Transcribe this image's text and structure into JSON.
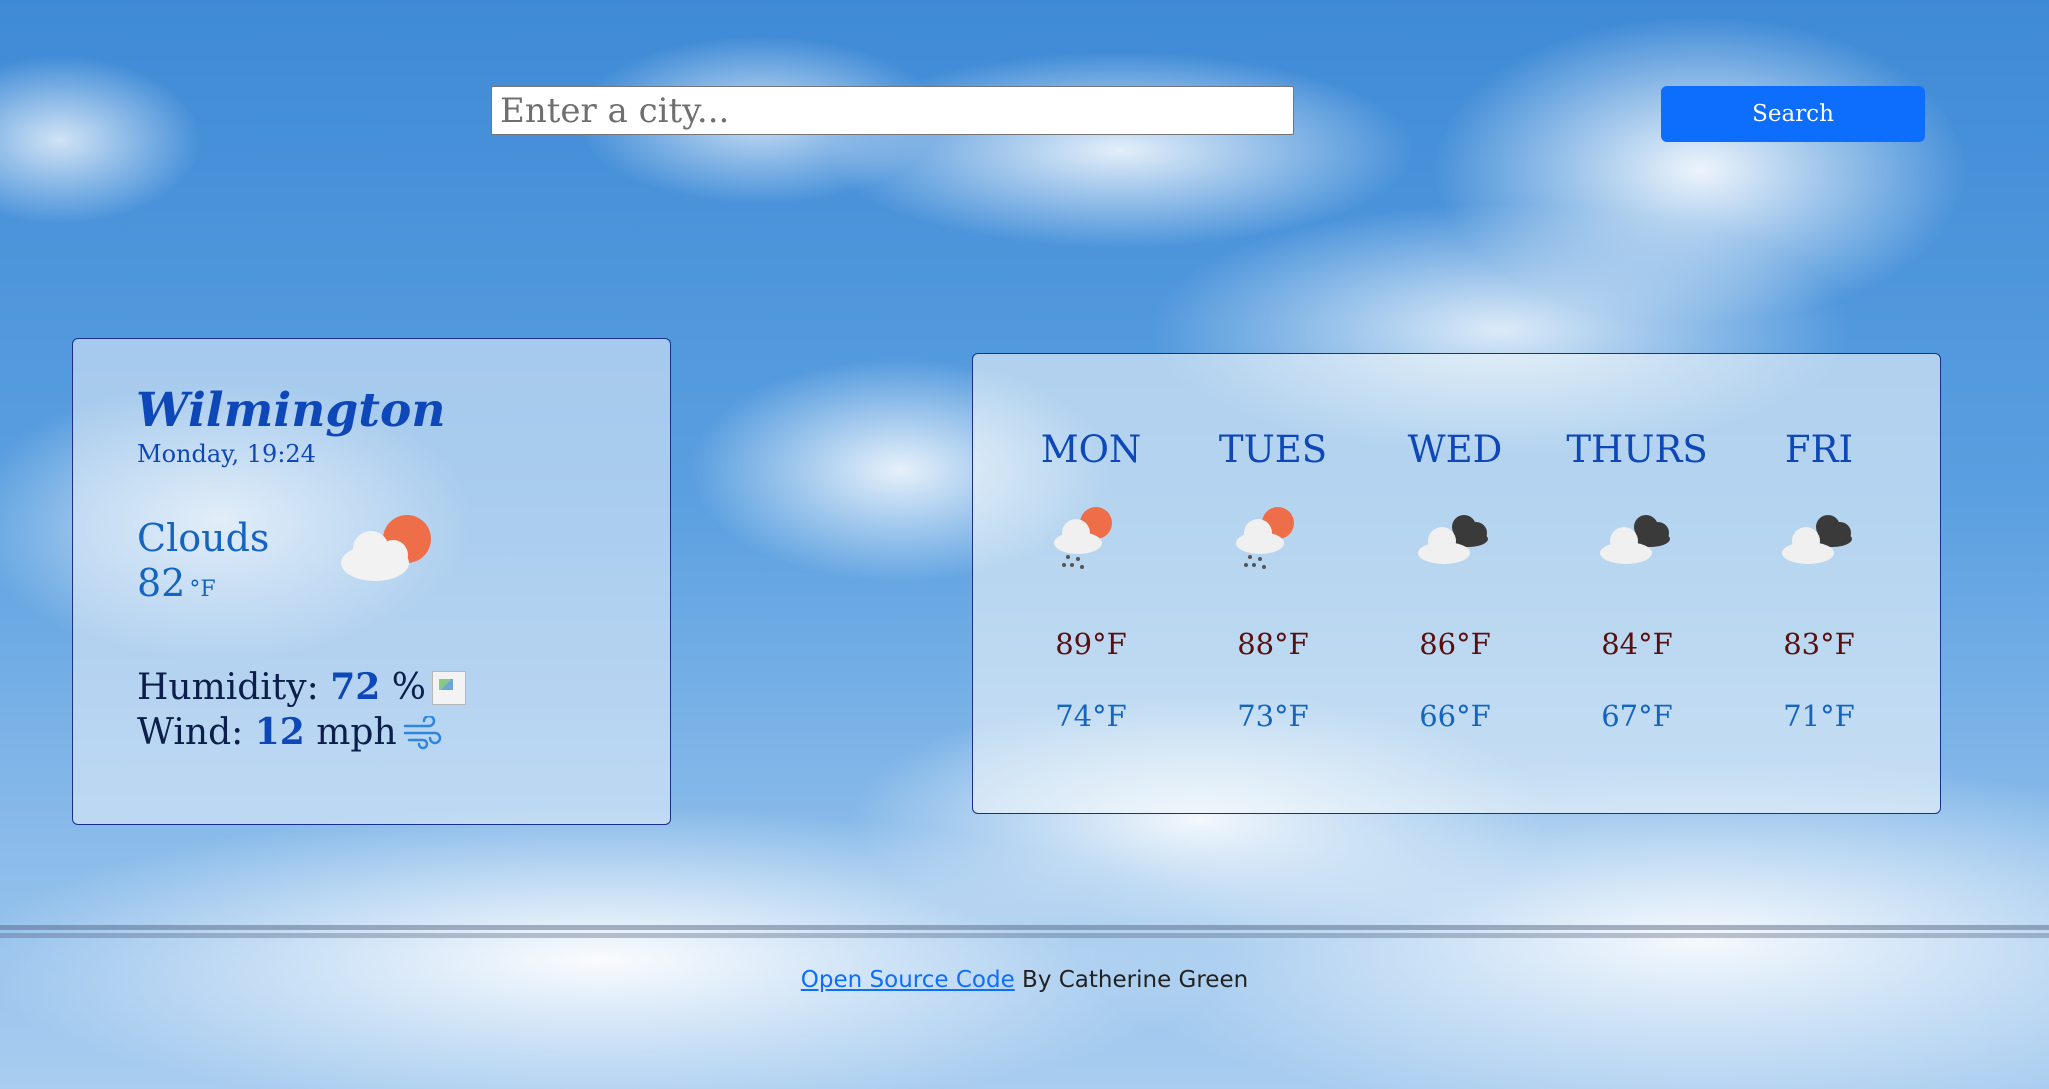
{
  "search": {
    "placeholder": "Enter a city...",
    "button_label": "Search"
  },
  "current": {
    "city": "Wilmington",
    "datetime": "Monday, 19:24",
    "condition": "Clouds",
    "temperature": "82",
    "unit": "°F",
    "icon": "partly-cloudy-day-icon",
    "humidity_label": "Humidity:",
    "humidity_value": "72",
    "humidity_unit": "%",
    "wind_label": "Wind:",
    "wind_value": "12",
    "wind_unit": "mph"
  },
  "forecast": [
    {
      "day": "MON",
      "high": "89°F",
      "low": "74°F",
      "icon": "rain-day-icon"
    },
    {
      "day": "TUES",
      "high": "88°F",
      "low": "73°F",
      "icon": "rain-day-icon"
    },
    {
      "day": "WED",
      "high": "86°F",
      "low": "66°F",
      "icon": "overcast-clouds-icon"
    },
    {
      "day": "THURS",
      "high": "84°F",
      "low": "67°F",
      "icon": "overcast-clouds-icon"
    },
    {
      "day": "FRI",
      "high": "83°F",
      "low": "71°F",
      "icon": "overcast-clouds-icon"
    }
  ],
  "footer": {
    "link_text": "Open Source Code",
    "credit": "By Catherine Green"
  },
  "colors": {
    "accent": "#0d6efd",
    "title": "#0d47b8",
    "high_temp": "#5a0f0f"
  }
}
